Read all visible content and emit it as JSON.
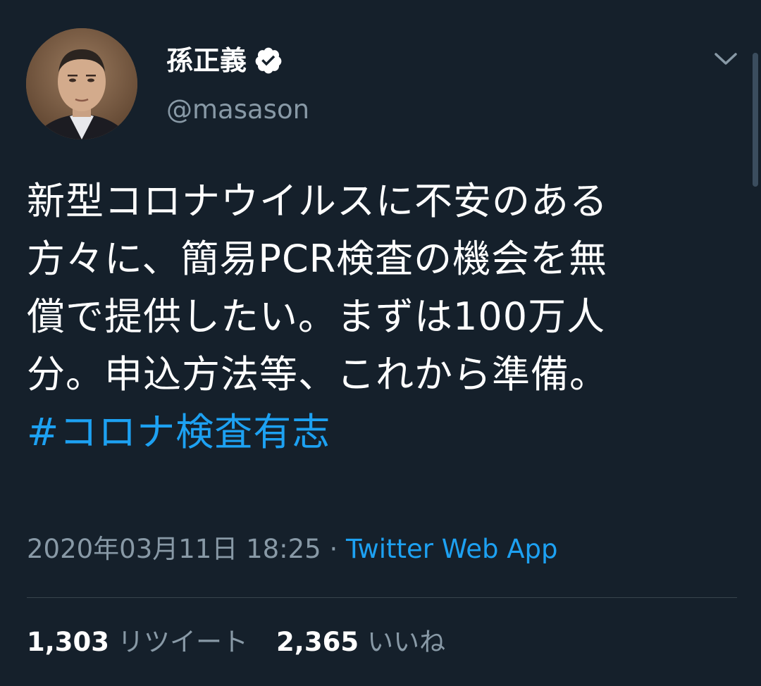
{
  "user": {
    "display_name": "孫正義",
    "handle": "@masason",
    "verified": true,
    "avatar_icon": "profile-photo"
  },
  "tweet": {
    "lines": [
      "新型コロナウイルスに不安のある",
      "方々に、簡易PCR検査の機会を無",
      "償で提供したい。まずは100万人",
      "分。申込方法等、これから準備。"
    ],
    "hashtag": "#コロナ検査有志"
  },
  "meta": {
    "timestamp": "2020年03月11日 18:25",
    "separator": " · ",
    "source": "Twitter Web App"
  },
  "stats": {
    "retweets_count": "1,303",
    "retweets_label": "リツイート",
    "likes_count": "2,365",
    "likes_label": "いいね"
  },
  "icons": {
    "verified": "verified-badge-icon",
    "caret": "chevron-down-icon"
  },
  "colors": {
    "background": "#15202b",
    "accent": "#1da1f2",
    "secondary_text": "#8899a6",
    "divider": "#38444d"
  }
}
